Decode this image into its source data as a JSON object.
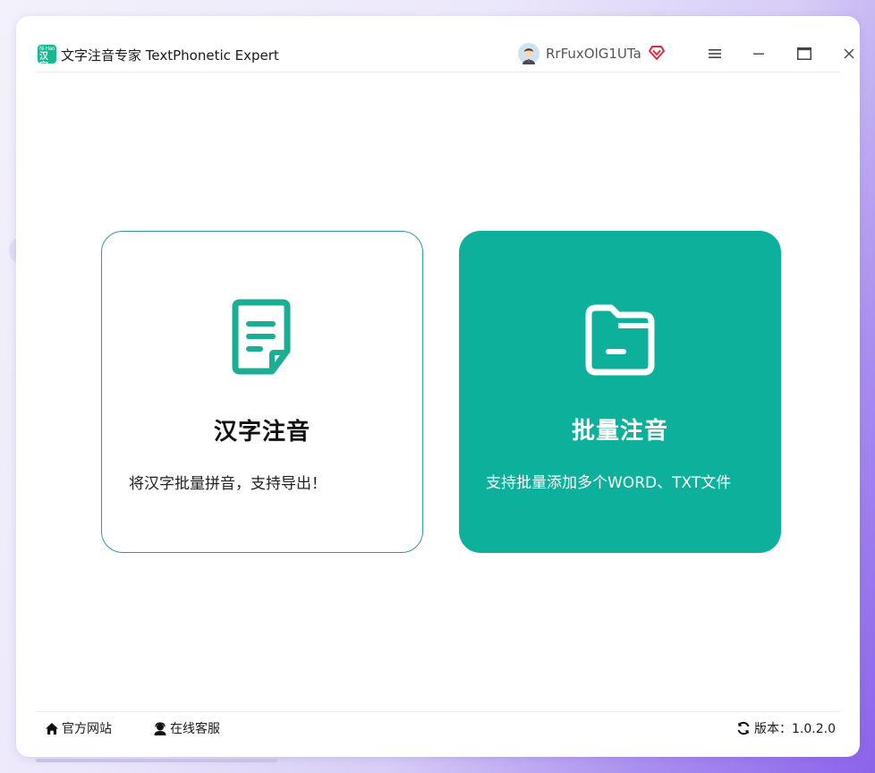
{
  "window": {
    "app_title": "文字注音专家 TextPhonetic Expert",
    "app_icon_top": "Ni Hao",
    "app_icon_text": "汉字",
    "username": "RrFuxOlG1UTa",
    "controls": [
      "menu-icon",
      "minimize-icon",
      "maximize-icon",
      "close-icon"
    ]
  },
  "cards": {
    "left": {
      "title": "汉字注音",
      "desc": "将汉字批量拼音，支持导出！",
      "icon": "document-icon",
      "accent": "#1aae95"
    },
    "right": {
      "title": "批量注音",
      "desc": "支持批量添加多个WORD、TXT文件",
      "icon": "folder-icon",
      "accent": "#0db19b"
    }
  },
  "footer": {
    "official_site": "官方网站",
    "online_service": "在线客服",
    "version_label": "版本：1.0.2.0"
  }
}
